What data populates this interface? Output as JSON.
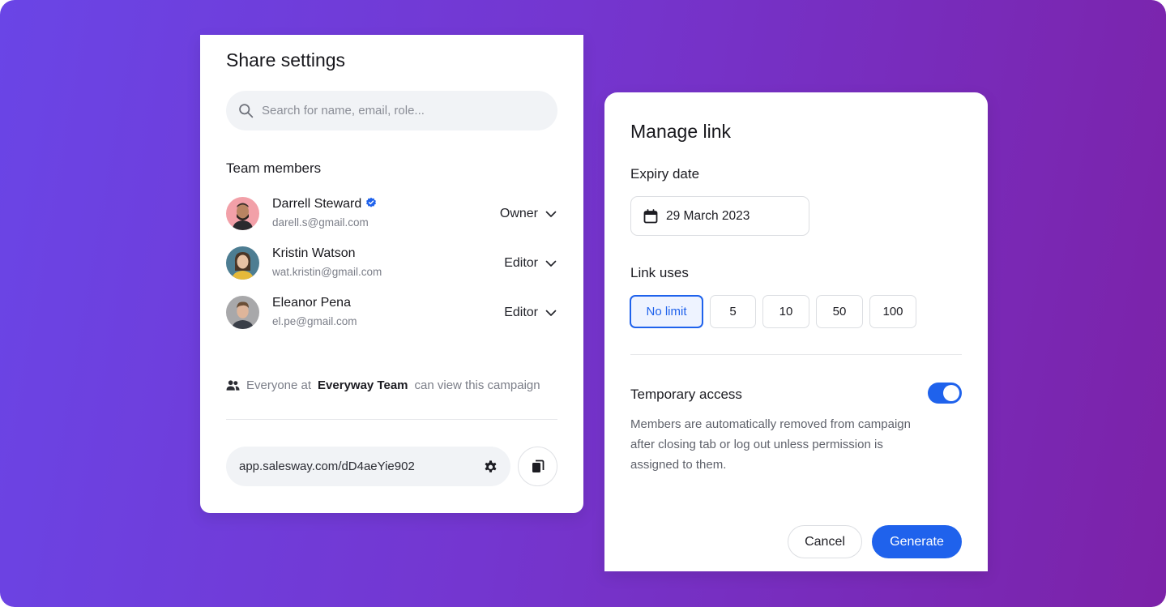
{
  "share": {
    "title": "Share settings",
    "search_placeholder": "Search for name, email, role...",
    "team_label": "Team members",
    "members": [
      {
        "name": "Darrell Steward",
        "email": "darell.s@gmail.com",
        "role": "Owner",
        "verified": true
      },
      {
        "name": "Kristin Watson",
        "email": "wat.kristin@gmail.com",
        "role": "Editor"
      },
      {
        "name": "Eleanor Pena",
        "email": "el.pe@gmail.com",
        "role": "Editor"
      }
    ],
    "everyone_prefix": "Everyone at",
    "everyone_team": "Everyway Team",
    "everyone_suffix": "can view this campaign",
    "link": "app.salesway.com/dD4aeYie902"
  },
  "manage": {
    "title": "Manage link",
    "expiry_label": "Expiry date",
    "expiry_value": "29 March 2023",
    "uses_label": "Link uses",
    "uses_options": [
      "No limit",
      "5",
      "10",
      "50",
      "100"
    ],
    "uses_selected": "No limit",
    "temp_label": "Temporary access",
    "temp_enabled": true,
    "temp_desc": "Members are automatically removed from campaign after closing tab or log out unless permission is assigned to them.",
    "cancel_label": "Cancel",
    "generate_label": "Generate"
  },
  "colors": {
    "accent": "#1f62ec",
    "gradient_start": "#6a45e6",
    "gradient_end": "#7c22a8"
  },
  "icons": [
    "search-icon",
    "verified-icon",
    "chevron-down-icon",
    "users-icon",
    "gear-icon",
    "copy-icon",
    "calendar-icon"
  ]
}
